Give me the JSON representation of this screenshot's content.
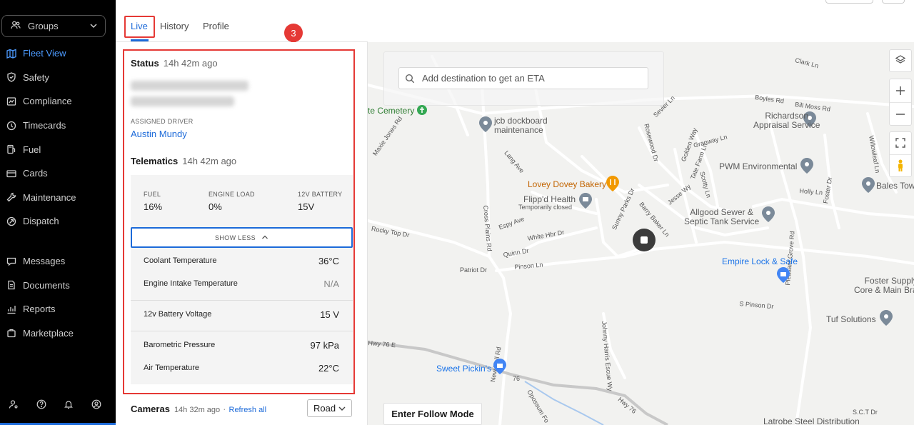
{
  "sidebar": {
    "groups_label": "Groups",
    "items": [
      {
        "label": "Fleet View",
        "icon": "map-icon",
        "active": true
      },
      {
        "label": "Safety",
        "icon": "shield-icon"
      },
      {
        "label": "Compliance",
        "icon": "compliance-icon"
      },
      {
        "label": "Timecards",
        "icon": "clock-icon"
      },
      {
        "label": "Fuel",
        "icon": "fuel-icon"
      },
      {
        "label": "Cards",
        "icon": "card-icon"
      },
      {
        "label": "Maintenance",
        "icon": "wrench-icon"
      },
      {
        "label": "Dispatch",
        "icon": "dispatch-icon"
      }
    ],
    "items2": [
      {
        "label": "Messages",
        "icon": "message-icon"
      },
      {
        "label": "Documents",
        "icon": "document-icon"
      },
      {
        "label": "Reports",
        "icon": "chart-icon"
      },
      {
        "label": "Marketplace",
        "icon": "bag-icon"
      }
    ],
    "bottom_icons": [
      "user-settings-icon",
      "help-icon",
      "bell-icon",
      "account-icon"
    ],
    "accent_color": "#1c6ad9"
  },
  "tabs": [
    {
      "label": "Live",
      "active": true
    },
    {
      "label": "History"
    },
    {
      "label": "Profile"
    }
  ],
  "step_marker": "3",
  "status": {
    "title": "Status",
    "ago": "14h 42m ago",
    "assigned_driver_caption": "ASSIGNED DRIVER",
    "driver_name": "Austin Mundy"
  },
  "telematics": {
    "title": "Telematics",
    "ago": "14h 42m ago",
    "metrics": [
      {
        "label": "FUEL",
        "value": "16%"
      },
      {
        "label": "ENGINE LOAD",
        "value": "0%"
      },
      {
        "label": "12V BATTERY",
        "value": "15V"
      }
    ],
    "toggle_label": "SHOW LESS",
    "rows": [
      {
        "label": "Coolant Temperature",
        "value": "36°C"
      },
      {
        "label": "Engine Intake Temperature",
        "value": "N/A"
      },
      {
        "label": "12v Battery Voltage",
        "value": "15 V"
      },
      {
        "label": "Barometric Pressure",
        "value": "97 kPa"
      },
      {
        "label": "Air Temperature",
        "value": "22°C"
      }
    ]
  },
  "cameras": {
    "title": "Cameras",
    "ago": "14h 32m ago",
    "separator": "·",
    "refresh_label": "Refresh all",
    "view_select": "Road"
  },
  "map": {
    "search_placeholder": "Add destination to get an ETA",
    "follow_button": "Enter Follow Mode",
    "places": [
      "Richardson\nAppraisal Service",
      "jcb dockboard\nmaintenance",
      "Lovey Dovey Bakery",
      "Flipp'd Health",
      "Temporarily closed",
      "PWM Environmental",
      "Bales Tow",
      "Allgood Sewer &\nSeptic Tank Service",
      "Empire Lock & Safe",
      "Foster Supply\nCore & Main Bra",
      "Tuf Solutions",
      "Sweet Pickin's",
      "Latrobe Steel Distribution",
      "te Cemetery"
    ],
    "streets": [
      "Clark Ln",
      "Boyles Rd",
      "Bill Moss Rd",
      "Sevier Ln",
      "Rosewood Dr",
      "Golden Way",
      "Granway Ln",
      "Tate Farm Ln",
      "Scotty Ln",
      "Willowleaf Ln",
      "Holly Ln",
      "Jesse Wy",
      "Foster Dr",
      "Maxie Jones Rd",
      "Lang Ave",
      "Espy Ave",
      "White Hbr Dr",
      "Rocky Top Dr",
      "Quinn Dr",
      "Pinson Ln",
      "Patriot Dr",
      "Cross Plains Rd",
      "Sunny Parks Dr",
      "Barry Baker Ln",
      "S Pinson Dr",
      "Pleasant Grove Rd",
      "Johnny Harris Escue Wy",
      "Hwy 76 E",
      "Hwy 76",
      "New Hall Rd",
      "Opossum Fo",
      "S.C.T Dr",
      "76"
    ]
  }
}
